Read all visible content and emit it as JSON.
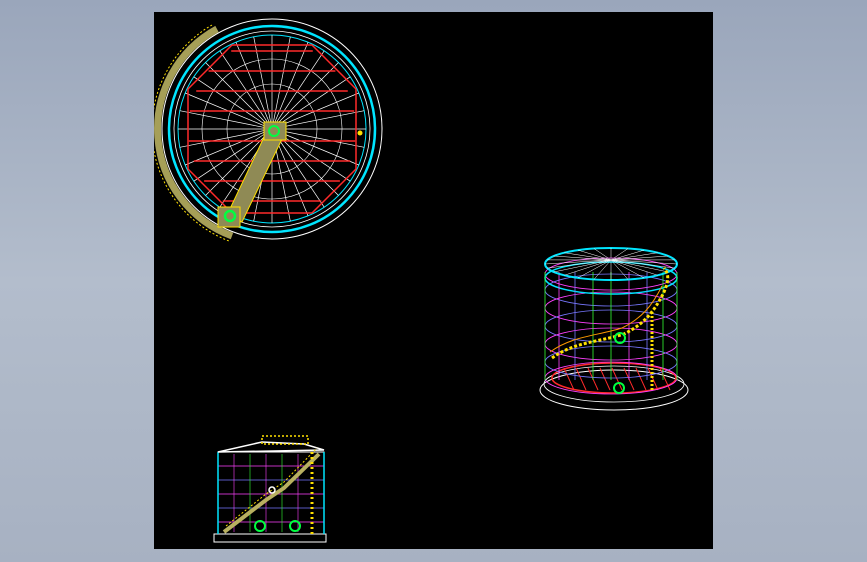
{
  "viewer": {
    "background": "#000000",
    "frame_color": "#a3aec0"
  },
  "drawing": {
    "views": [
      {
        "name": "plan-view",
        "kind": "top plan of storage tank with radial roof rafters"
      },
      {
        "name": "isometric-view",
        "kind": "3D wireframe of tank with spiral stair"
      },
      {
        "name": "elevation-view",
        "kind": "side elevation of tank with stair and nozzles"
      }
    ],
    "plan_rafter_count": 32,
    "colors": {
      "shell": "#00e5ff",
      "rings": "#ffffff",
      "rafters": "#ff2a2a",
      "stair": "#b8b060",
      "nozzle": "#00ff40",
      "accent_yellow": "#ffe000",
      "accent_orange": "#ff9a00",
      "magenta": "#ff40ff",
      "green": "#33ff33"
    }
  }
}
